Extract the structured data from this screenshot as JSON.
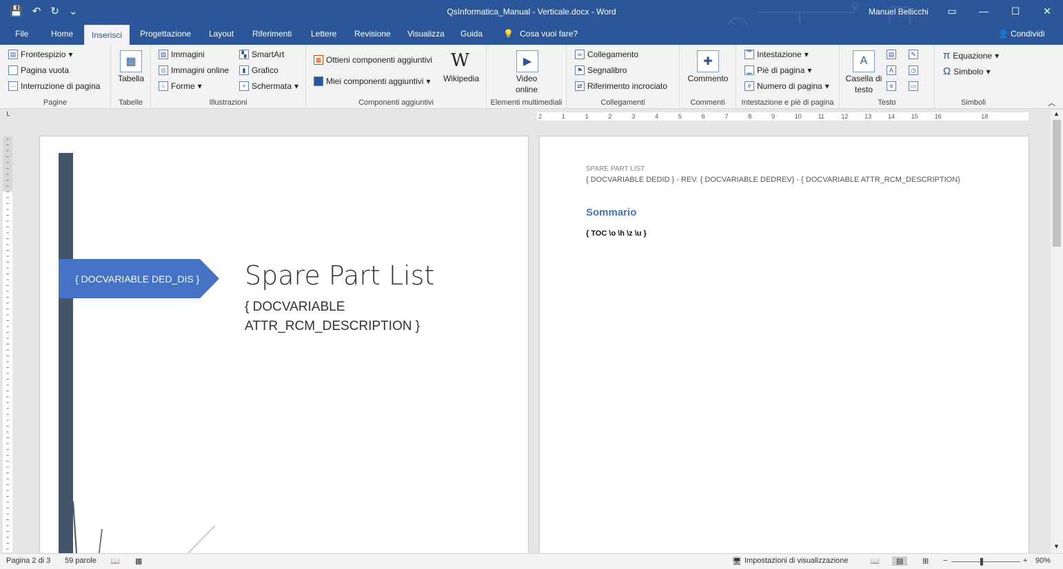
{
  "window": {
    "title": "QsInformatica_Manual - Verticale.docx - Word",
    "user": "Manuel Bellicchi",
    "minimize": "—",
    "maximize": "☐",
    "close": "✕"
  },
  "qat": {
    "save": "💾",
    "undo": "↶",
    "redo": "↻",
    "customize": "⌄"
  },
  "tabs": [
    {
      "label": "File"
    },
    {
      "label": "Home"
    },
    {
      "label": "Inserisci"
    },
    {
      "label": "Progettazione"
    },
    {
      "label": "Layout"
    },
    {
      "label": "Riferimenti"
    },
    {
      "label": "Lettere"
    },
    {
      "label": "Revisione"
    },
    {
      "label": "Visualizza"
    },
    {
      "label": "Guida"
    }
  ],
  "tellme": "Cosa vuoi fare?",
  "share": "Condividi",
  "ribbon": {
    "pagine": {
      "label": "Pagine",
      "frontespizio": "Frontespizio",
      "pagina_vuota": "Pagina vuota",
      "interruzione": "Interruzione di pagina"
    },
    "tabelle": {
      "label": "Tabelle",
      "tabella": "Tabella"
    },
    "illustrazioni": {
      "label": "Illustrazioni",
      "immagini": "Immagini",
      "immagini_online": "Immagini online",
      "forme": "Forme",
      "smartart": "SmartArt",
      "grafico": "Grafico",
      "schermata": "Schermata"
    },
    "componenti": {
      "label": "Componenti aggiuntivi",
      "ottieni": "Ottieni componenti aggiuntivi",
      "miei": "Miei componenti aggiuntivi",
      "wikipedia": "Wikipedia"
    },
    "multimedia": {
      "label": "Elementi multimediali",
      "video_line1": "Video",
      "video_line2": "online"
    },
    "collegamenti": {
      "label": "Collegamenti",
      "collegamento": "Collegamento",
      "segnalibro": "Segnalibro",
      "riferimento": "Riferimento incrociato"
    },
    "commenti": {
      "label": "Commenti",
      "commento": "Commento"
    },
    "intestazione": {
      "label": "Intestazione e piè di pagina",
      "intestazione": "Intestazione",
      "pie": "Piè di pagina",
      "numero": "Numero di pagina"
    },
    "testo": {
      "label": "Testo",
      "casella_line1": "Casella di",
      "casella_line2": "testo"
    },
    "simboli": {
      "label": "Simboli",
      "equazione": "Equazione",
      "simbolo": "Simbolo"
    }
  },
  "ruler_numbers": [
    "2",
    "1",
    "1",
    "2",
    "3",
    "4",
    "5",
    "6",
    "7",
    "8",
    "9",
    "10",
    "11",
    "12",
    "13",
    "14",
    "15",
    "16",
    "18"
  ],
  "page1": {
    "banner": "{ DOCVARIABLE  DED_DIS }",
    "title": "Spare Part List",
    "subtitle": "{ DOCVARIABLE ATTR_RCM_DESCRIPTION }"
  },
  "page2": {
    "header_small": "SPARE PART LIST",
    "header_fields": "{ DOCVARIABLE  DEDID  } - REV. { DOCVARIABLE  DEDREV} - { DOCVARIABLE  ATTR_RCM_DESCRIPTION}",
    "sommario": "Sommario",
    "toc": "{ TOC \\o \\h \\z \\u }"
  },
  "status": {
    "page": "Pagina 2 di 3",
    "words": "59 parole",
    "display_settings": "Impostazioni di visualizzazione",
    "zoom": "90%",
    "minus": "−",
    "plus": "+"
  }
}
